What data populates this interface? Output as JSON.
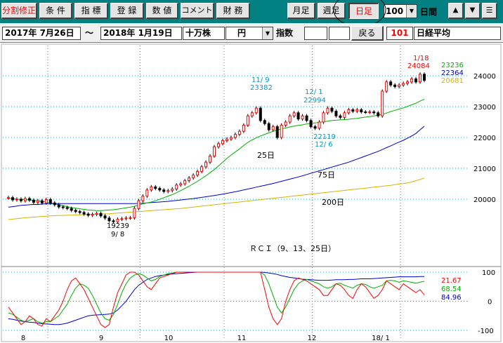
{
  "toolbar": {
    "buttons": [
      {
        "label": "分割修正",
        "color": "#ff0000"
      },
      {
        "label": "条 件",
        "color": "#000000"
      },
      {
        "label": "指 標",
        "color": "#000000"
      },
      {
        "label": "登 録",
        "color": "#000000"
      },
      {
        "label": "数 値",
        "color": "#000000"
      },
      {
        "label": "コメント",
        "color": "#000000"
      },
      {
        "label": "財 務",
        "color": "#000000"
      }
    ],
    "period_buttons": [
      {
        "label": "月足",
        "active": false
      },
      {
        "label": "週足",
        "active": false
      },
      {
        "label": "日足",
        "active": true
      }
    ],
    "count_value": "100",
    "count_unit": "日間",
    "nav_icons": [
      "up-arrow-icon",
      "down-arrow-icon",
      "menu-icon"
    ]
  },
  "bar2": {
    "date_from": "2017年 7月26日",
    "tilde": "～",
    "date_to": "2018年 1月19日",
    "unit_label": "十万株",
    "currency_value": "円",
    "index_label": "指数",
    "back_button": "戻る",
    "code": "101",
    "name": "日経平均"
  },
  "colors": {
    "candle_up": "#ff0000",
    "candle_down": "#000000",
    "ma25": "#00b000",
    "ma75": "#0000cc",
    "ma200": "#d4b400",
    "rci9": "#ff0000",
    "rci13": "#00b000",
    "rci25": "#0000cc"
  },
  "chart_data": {
    "type": "candlestick",
    "months": [
      "8",
      "9",
      "10",
      "11",
      "12",
      "18/ 1"
    ],
    "price_axis": {
      "min": 19000,
      "max": 24500,
      "ticks": [
        20000,
        21000,
        22000,
        23000,
        24000
      ]
    },
    "rci_axis": {
      "min": -100,
      "max": 100,
      "ticks": [
        100,
        0,
        -100
      ]
    },
    "ma_values": {
      "ma25": "23236",
      "ma75": "22364",
      "ma200": "20681"
    },
    "ma_labels": {
      "ma25": "25日",
      "ma75": "75日",
      "ma200": "200日"
    },
    "rci_values": {
      "rci9": "21.67",
      "rci13": "68.54",
      "rci25": "84.96"
    },
    "rci_title": "ＲＣＩ（9、13、25日）",
    "annotations": [
      {
        "date": "1/18",
        "value": "24084",
        "color": "#ff0000"
      },
      {
        "date": "11/ 9",
        "value": "23382",
        "color": "#0099cc"
      },
      {
        "date": "12/ 1",
        "value": "22994",
        "color": "#0099cc"
      },
      {
        "date": "12/ 6",
        "value": "22119",
        "color": "#0099cc"
      },
      {
        "date": "9/ 8",
        "value": "19239",
        "color": "#000000"
      }
    ],
    "closes": [
      20050,
      19980,
      20000,
      19950,
      20020,
      19970,
      19900,
      19950,
      19880,
      19990,
      19880,
      19820,
      19750,
      19730,
      19700,
      19640,
      19600,
      19570,
      19520,
      19480,
      19510,
      19540,
      19460,
      19390,
      19300,
      19270,
      19350,
      19370,
      19390,
      19400,
      19700,
      19950,
      20100,
      20300,
      20400,
      20350,
      20300,
      20250,
      20280,
      20330,
      20460,
      20500,
      20600,
      20690,
      20780,
      20900,
      21050,
      21200,
      21400,
      21700,
      21800,
      21900,
      21950,
      22000,
      22100,
      22200,
      22400,
      22700,
      22800,
      22950,
      22550,
      22450,
      22250,
      22350,
      22000,
      22400,
      22500,
      22700,
      22800,
      22600,
      22700,
      22550,
      22350,
      22300,
      22500,
      22800,
      22950,
      22850,
      22700,
      22650,
      22800,
      22900,
      22850,
      22900,
      22830,
      22820,
      22830,
      22800,
      22700,
      23500,
      23800,
      23700,
      23650,
      23700,
      23750,
      23800,
      23900,
      23800,
      24050,
      23850
    ],
    "ma25": [
      20030,
      20020,
      20000,
      19990,
      19990,
      19970,
      19960,
      19950,
      19930,
      19910,
      19880,
      19850,
      19820,
      19790,
      19760,
      19730,
      19710,
      19690,
      19670,
      19650,
      19640,
      19630,
      19630,
      19640,
      19650,
      19660,
      19680,
      19700,
      19720,
      19740,
      19770,
      19810,
      19850,
      19880,
      19910,
      19950,
      20000,
      20050,
      20100,
      20150,
      20210,
      20280,
      20350,
      20420,
      20500,
      20580,
      20670,
      20760,
      20860,
      20960,
      21080,
      21200,
      21320,
      21430,
      21530,
      21630,
      21740,
      21840,
      21920,
      21990,
      22050,
      22100,
      22150,
      22200,
      22240,
      22280,
      22310,
      22340,
      22370,
      22390,
      22410,
      22440,
      22460,
      22470,
      22490,
      22510,
      22530,
      22550,
      22560,
      22570,
      22580,
      22590,
      22610,
      22620,
      22640,
      22660,
      22680,
      22700,
      22720,
      22750,
      22790,
      22840,
      22880,
      22920,
      22960,
      23010,
      23060,
      23110,
      23180,
      23236
    ],
    "ma75": [
      19740,
      19760,
      19780,
      19800,
      19810,
      19820,
      19830,
      19830,
      19840,
      19850,
      19850,
      19860,
      19860,
      19860,
      19860,
      19860,
      19860,
      19860,
      19860,
      19860,
      19860,
      19860,
      19860,
      19860,
      19860,
      19860,
      19860,
      19860,
      19860,
      19860,
      19860,
      19865,
      19870,
      19880,
      19890,
      19900,
      19910,
      19920,
      19930,
      19945,
      19960,
      19975,
      19990,
      20005,
      20020,
      20040,
      20060,
      20080,
      20100,
      20120,
      20140,
      20165,
      20190,
      20215,
      20240,
      20270,
      20300,
      20330,
      20360,
      20390,
      20420,
      20450,
      20480,
      20510,
      20545,
      20580,
      20615,
      20650,
      20685,
      20720,
      20760,
      20800,
      20840,
      20880,
      20920,
      20960,
      21000,
      21040,
      21080,
      21120,
      21160,
      21200,
      21250,
      21300,
      21350,
      21400,
      21450,
      21500,
      21550,
      21610,
      21670,
      21730,
      21790,
      21850,
      21910,
      21980,
      22050,
      22130,
      22250,
      22364
    ],
    "ma200": [
      19340,
      19355,
      19370,
      19385,
      19400,
      19410,
      19420,
      19430,
      19440,
      19450,
      19460,
      19465,
      19470,
      19475,
      19480,
      19485,
      19490,
      19495,
      19500,
      19505,
      19510,
      19515,
      19520,
      19525,
      19530,
      19540,
      19550,
      19560,
      19570,
      19580,
      19590,
      19600,
      19610,
      19620,
      19630,
      19640,
      19650,
      19660,
      19670,
      19680,
      19690,
      19700,
      19715,
      19730,
      19745,
      19760,
      19775,
      19790,
      19805,
      19820,
      19835,
      19850,
      19865,
      19880,
      19895,
      19910,
      19925,
      19940,
      19955,
      19970,
      19985,
      20000,
      20015,
      20030,
      20045,
      20060,
      20075,
      20090,
      20105,
      20120,
      20135,
      20150,
      20165,
      20180,
      20195,
      20210,
      20225,
      20240,
      20255,
      20270,
      20285,
      20300,
      20315,
      20330,
      20345,
      20360,
      20375,
      20390,
      20405,
      20420,
      20435,
      20450,
      20470,
      20490,
      20510,
      20530,
      20560,
      20600,
      20640,
      20681
    ],
    "rci9": [
      -20,
      -40,
      -60,
      -80,
      -70,
      -50,
      -60,
      -80,
      -85,
      -60,
      -70,
      -50,
      -30,
      0,
      40,
      70,
      80,
      60,
      40,
      10,
      -20,
      -50,
      -80,
      -90,
      -80,
      -20,
      30,
      60,
      90,
      100,
      100,
      90,
      70,
      50,
      40,
      60,
      80,
      85,
      90,
      95,
      100,
      100,
      100,
      100,
      100,
      100,
      100,
      100,
      100,
      100,
      100,
      100,
      100,
      100,
      100,
      100,
      100,
      100,
      100,
      100,
      100,
      40,
      -20,
      -60,
      -80,
      -60,
      0,
      40,
      70,
      80,
      75,
      70,
      60,
      50,
      40,
      20,
      20,
      40,
      60,
      55,
      40,
      20,
      10,
      40,
      60,
      50,
      30,
      10,
      20,
      40,
      70,
      60,
      50,
      40,
      60,
      50,
      40,
      30,
      40,
      21.67
    ],
    "rci13": [
      -40,
      -45,
      -55,
      -65,
      -70,
      -65,
      -60,
      -70,
      -75,
      -70,
      -70,
      -60,
      -50,
      -30,
      -10,
      20,
      45,
      60,
      55,
      45,
      20,
      -10,
      -40,
      -60,
      -65,
      -45,
      -10,
      30,
      60,
      80,
      90,
      95,
      90,
      80,
      70,
      75,
      85,
      90,
      95,
      97,
      100,
      100,
      100,
      100,
      100,
      100,
      100,
      100,
      100,
      100,
      100,
      100,
      100,
      100,
      100,
      100,
      100,
      100,
      100,
      100,
      100,
      90,
      60,
      20,
      -20,
      -40,
      -20,
      10,
      40,
      60,
      70,
      75,
      70,
      65,
      60,
      50,
      45,
      50,
      60,
      62,
      55,
      50,
      45,
      55,
      60,
      58,
      50,
      45,
      50,
      55,
      70,
      72,
      70,
      65,
      70,
      68,
      65,
      62,
      66,
      68.54
    ],
    "rci25": [
      -60,
      -62,
      -65,
      -68,
      -70,
      -72,
      -73,
      -75,
      -77,
      -78,
      -79,
      -80,
      -80,
      -78,
      -75,
      -70,
      -65,
      -60,
      -55,
      -50,
      -48,
      -47,
      -46,
      -45,
      -44,
      -40,
      -30,
      -15,
      0,
      20,
      40,
      55,
      65,
      75,
      80,
      85,
      88,
      90,
      92,
      94,
      95,
      96,
      97,
      98,
      99,
      100,
      100,
      100,
      100,
      100,
      100,
      100,
      100,
      100,
      100,
      100,
      100,
      100,
      100,
      100,
      100,
      99,
      97,
      95,
      92,
      88,
      85,
      82,
      80,
      78,
      76,
      75,
      74,
      73,
      72,
      72,
      72,
      73,
      74,
      74,
      74,
      75,
      75,
      76,
      77,
      77,
      77,
      78,
      79,
      80,
      81,
      82,
      83,
      84,
      84,
      84,
      84,
      84,
      85,
      84.96
    ]
  }
}
